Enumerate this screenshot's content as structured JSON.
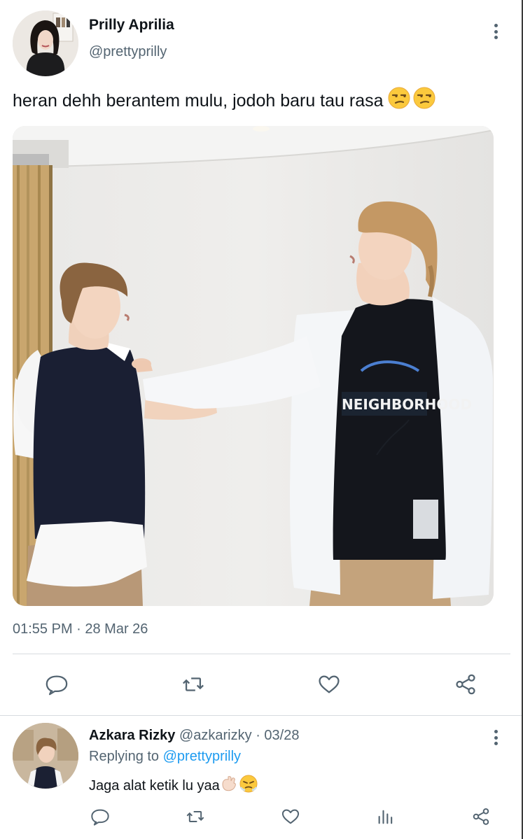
{
  "tweet": {
    "author_name": "Prilly Aprilia",
    "author_handle": "@prettyprilly",
    "text": "heran dehh berantem mulu, jodoh baru tau rasa",
    "text_emojis": "😒😒",
    "timestamp": "01:55 PM · 28 Mar 26",
    "image_shirt_text": "NEIGHBORHOOD",
    "actions": [
      "reply-icon",
      "retweet-icon",
      "like-icon",
      "share-icon"
    ]
  },
  "reply": {
    "author_name": "Azkara Rizky",
    "author_handle": "@azkarizky",
    "date": "· 03/28",
    "replying_label": "Replying to",
    "replying_to": "@prettyprilly",
    "text": "Jaga alat ketik lu yaa",
    "text_emojis": "🫷🏻😤",
    "actions": [
      "reply-icon",
      "retweet-icon",
      "like-icon",
      "views-icon",
      "share-icon"
    ]
  },
  "colors": {
    "text_primary": "#0f1419",
    "text_secondary": "#536471",
    "link": "#1d9bf0",
    "divider": "#d7dbdf",
    "icon": "#536471"
  }
}
